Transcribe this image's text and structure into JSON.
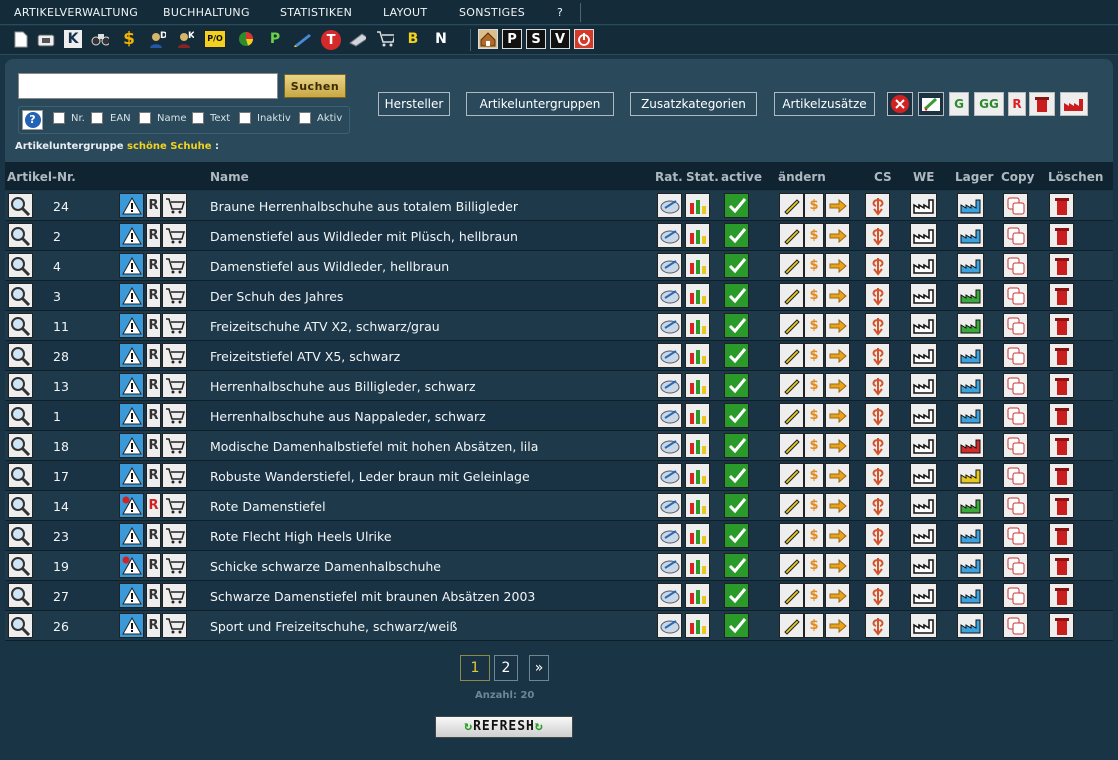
{
  "menu": {
    "items": [
      "ARTIKELVERWALTUNG",
      "BUCHHALTUNG",
      "STATISTIKEN",
      "LAYOUT",
      "SONSTIGES",
      "?"
    ]
  },
  "toolbar": {
    "icons": [
      "document-icon",
      "telephone-icon",
      "k-icon",
      "binoculars-icon",
      "dollar-icon",
      "customer-d-icon",
      "customer-k-icon",
      "po-icon",
      "pie-chart-icon",
      "p-icon",
      "pen-icon",
      "t-icon",
      "truck-icon",
      "cart-icon",
      "b-icon",
      "n-icon"
    ],
    "po_label": "P/O",
    "k_label": "K",
    "p_label": "P",
    "t_label": "T",
    "b_label": "B",
    "n_label": "N",
    "boxes": [
      "P",
      "S",
      "V"
    ]
  },
  "search": {
    "value": "",
    "button_label": "Suchen",
    "filters": [
      {
        "label": "Nr.",
        "checked": false
      },
      {
        "label": "EAN",
        "checked": false
      },
      {
        "label": "Name",
        "checked": false
      },
      {
        "label": "Text",
        "checked": false
      },
      {
        "label": "Inaktiv",
        "checked": false
      },
      {
        "label": "Aktiv",
        "checked": false
      }
    ]
  },
  "categories": {
    "hersteller": "Hersteller",
    "artikeluntergruppen": "Artikeluntergruppen",
    "zusatzkategorien": "Zusatzkategorien",
    "artikelzusaetze": "Artikelzusätze"
  },
  "action_icons": {
    "g_label": "G",
    "gg_label": "GG",
    "r_label": "R"
  },
  "subgroup": {
    "label": "Artikeluntergruppe",
    "name": "schöne Schuhe",
    "suffix": ":"
  },
  "table": {
    "headers": {
      "artnr": "Artikel-Nr.",
      "name": "Name",
      "rat": "Rat.",
      "stat": "Stat.",
      "active": "active",
      "aendern": "ändern",
      "cs": "CS",
      "we": "WE",
      "lager": "Lager",
      "copy": "Copy",
      "loeschen": "Löschen"
    },
    "rows": [
      {
        "nr": "24",
        "name": "Braune Herrenhalbschuhe aus totalem Billigleder",
        "lager_color": "blue",
        "r_red": false,
        "warn_dot": false
      },
      {
        "nr": "2",
        "name": "Damenstiefel aus Wildleder mit Plüsch, hellbraun",
        "lager_color": "blue",
        "r_red": false,
        "warn_dot": false
      },
      {
        "nr": "4",
        "name": "Damenstiefel aus Wildleder, hellbraun",
        "lager_color": "blue",
        "r_red": false,
        "warn_dot": false
      },
      {
        "nr": "3",
        "name": "Der Schuh des Jahres",
        "lager_color": "green",
        "r_red": false,
        "warn_dot": false
      },
      {
        "nr": "11",
        "name": "Freizeitschuhe ATV X2, schwarz/grau",
        "lager_color": "green",
        "r_red": false,
        "warn_dot": false
      },
      {
        "nr": "28",
        "name": "Freizeitstiefel ATV X5, schwarz",
        "lager_color": "blue",
        "r_red": false,
        "warn_dot": false
      },
      {
        "nr": "13",
        "name": "Herrenhalbschuhe aus Billigleder, schwarz",
        "lager_color": "blue",
        "r_red": false,
        "warn_dot": false
      },
      {
        "nr": "1",
        "name": "Herrenhalbschuhe aus Nappaleder, schwarz",
        "lager_color": "blue",
        "r_red": false,
        "warn_dot": false
      },
      {
        "nr": "18",
        "name": "Modische Damenhalbstiefel mit hohen Absätzen, lila",
        "lager_color": "red",
        "r_red": false,
        "warn_dot": false
      },
      {
        "nr": "17",
        "name": "Robuste Wanderstiefel, Leder braun mit Geleinlage",
        "lager_color": "yellow",
        "r_red": false,
        "warn_dot": false
      },
      {
        "nr": "14",
        "name": "Rote Damenstiefel",
        "lager_color": "green",
        "r_red": true,
        "warn_dot": true
      },
      {
        "nr": "23",
        "name": "Rote Flecht High Heels Ulrike",
        "lager_color": "blue",
        "r_red": false,
        "warn_dot": false
      },
      {
        "nr": "19",
        "name": "Schicke schwarze Damenhalbschuhe",
        "lager_color": "blue",
        "r_red": false,
        "warn_dot": true
      },
      {
        "nr": "27",
        "name": "Schwarze Damenstiefel mit braunen Absätzen 2003",
        "lager_color": "blue",
        "r_red": false,
        "warn_dot": false
      },
      {
        "nr": "26",
        "name": "Sport und Freizeitschuhe, schwarz/weiß",
        "lager_color": "blue",
        "r_red": false,
        "warn_dot": false
      }
    ]
  },
  "pagination": {
    "pages": [
      "1",
      "2"
    ],
    "current": "1",
    "next": "»"
  },
  "count_label": "Anzahl: 20",
  "refresh_label": "REFRESH",
  "colors": {
    "background": "#193545",
    "subgroup_highlight": "#f2d21e",
    "active_page": "#e3c83e"
  }
}
